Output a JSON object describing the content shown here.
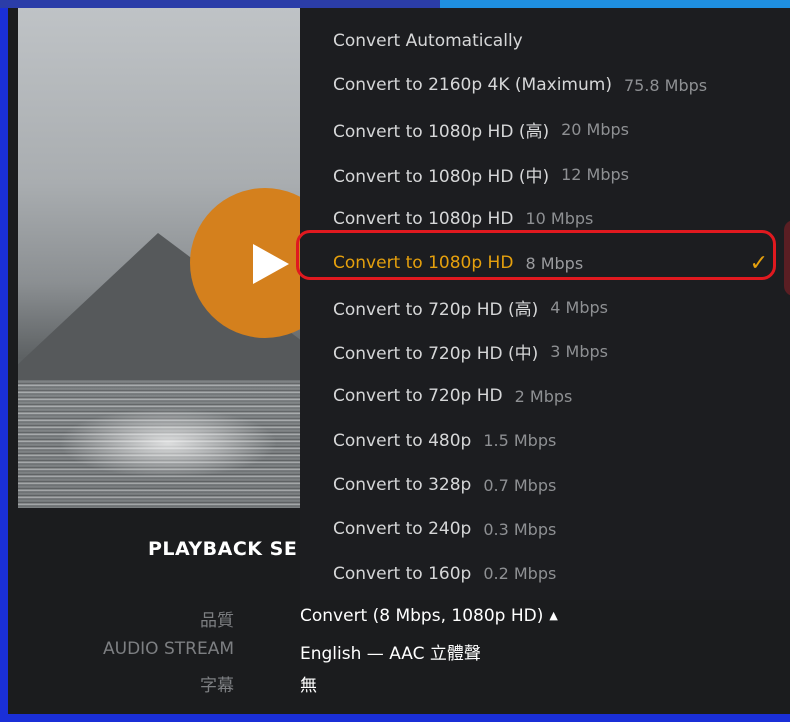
{
  "colors": {
    "accent": "#e5a00d",
    "play_button": "#d4801d",
    "highlight_border": "#e0191f",
    "menu_background": "#1c1d20",
    "frame_border": "#1a2fd8"
  },
  "playback": {
    "section_title": "PLAYBACK SE"
  },
  "quality_menu": {
    "items": [
      {
        "label": "Convert Automatically",
        "rate": ""
      },
      {
        "label": "Convert to 2160p 4K (Maximum)",
        "rate": "75.8 Mbps"
      },
      {
        "label": "Convert to 1080p HD (高)",
        "rate": "20 Mbps"
      },
      {
        "label": "Convert to 1080p HD (中)",
        "rate": "12 Mbps"
      },
      {
        "label": "Convert to 1080p HD",
        "rate": "10 Mbps"
      },
      {
        "label": "Convert to 1080p HD",
        "rate": "8 Mbps",
        "selected": true
      },
      {
        "label": "Convert to 720p HD (高)",
        "rate": "4 Mbps"
      },
      {
        "label": "Convert to 720p HD (中)",
        "rate": "3 Mbps"
      },
      {
        "label": "Convert to 720p HD",
        "rate": "2 Mbps"
      },
      {
        "label": "Convert to 480p",
        "rate": "1.5 Mbps"
      },
      {
        "label": "Convert to 328p",
        "rate": "0.7 Mbps"
      },
      {
        "label": "Convert to 240p",
        "rate": "0.3 Mbps"
      },
      {
        "label": "Convert to 160p",
        "rate": "0.2 Mbps"
      }
    ],
    "selected_check": "✓"
  },
  "settings": {
    "quality_label": "品質",
    "quality_value": "Convert (8 Mbps, 1080p HD)",
    "quality_caret": "▲",
    "audio_label": "AUDIO STREAM",
    "audio_value": "English — AAC 立體聲",
    "subtitle_label": "字幕",
    "subtitle_value": "無"
  },
  "icons": {
    "play": "play-icon",
    "check": "checkmark-icon",
    "caret": "caret-up-icon"
  }
}
